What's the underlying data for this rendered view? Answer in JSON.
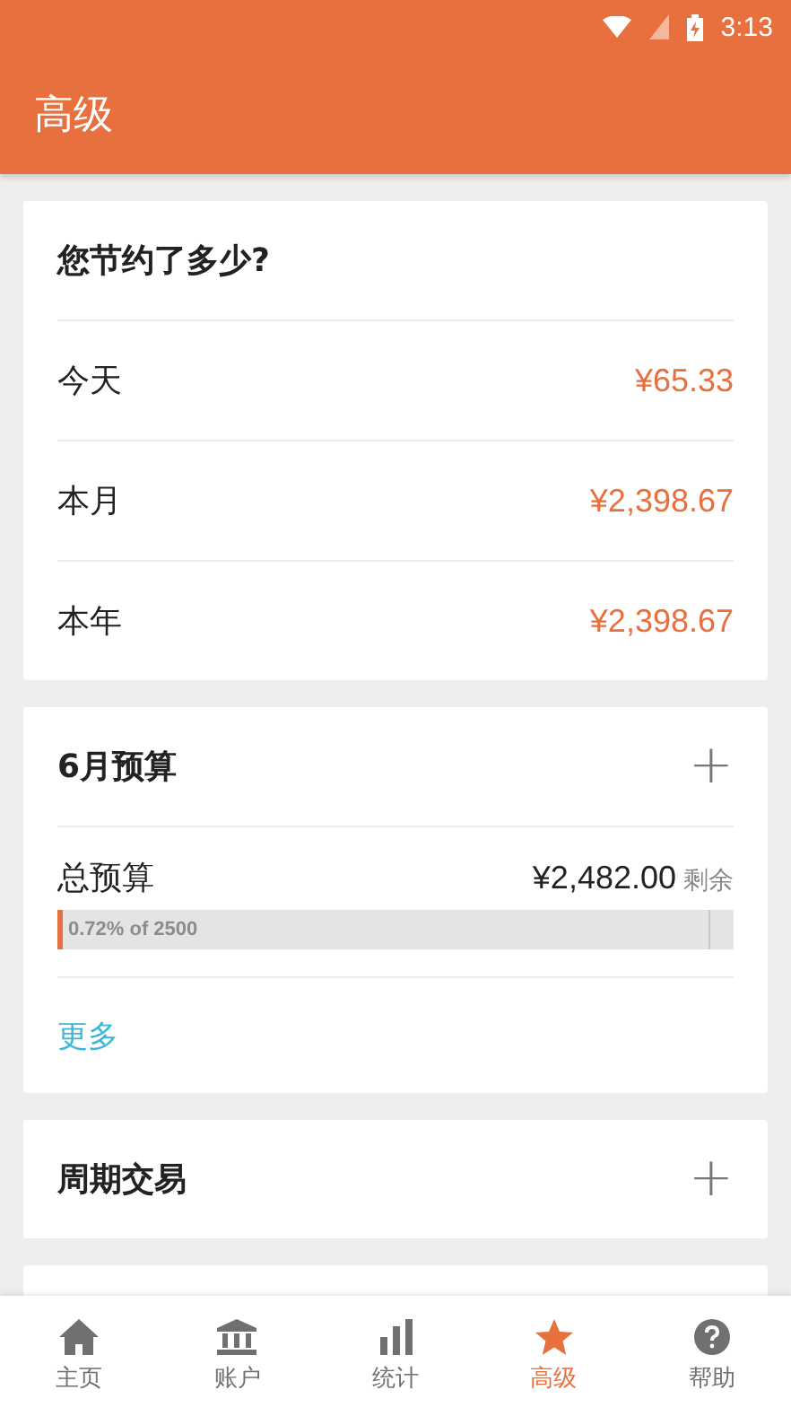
{
  "status_bar": {
    "time": "3:13"
  },
  "header": {
    "title": "高级"
  },
  "savings": {
    "title": "您节约了多少?",
    "rows": [
      {
        "label": "今天",
        "amount": "¥65.33"
      },
      {
        "label": "本月",
        "amount": "¥2,398.67"
      },
      {
        "label": "本年",
        "amount": "¥2,398.67"
      }
    ]
  },
  "budget": {
    "title": "6月预算",
    "add": "+",
    "item": {
      "label": "总预算",
      "amount": "¥2,482.00",
      "suffix": "剩余",
      "level": 0.0072,
      "bar_text": "0.72%  of  2500"
    },
    "more": "更多"
  },
  "recurring": {
    "title": "周期交易",
    "add": "+"
  },
  "nav": [
    {
      "label": "主页",
      "selected": false
    },
    {
      "label": "账户",
      "selected": false
    },
    {
      "label": "统计",
      "selected": false
    },
    {
      "label": "高级",
      "selected": true
    },
    {
      "label": "帮助",
      "selected": false
    }
  ]
}
